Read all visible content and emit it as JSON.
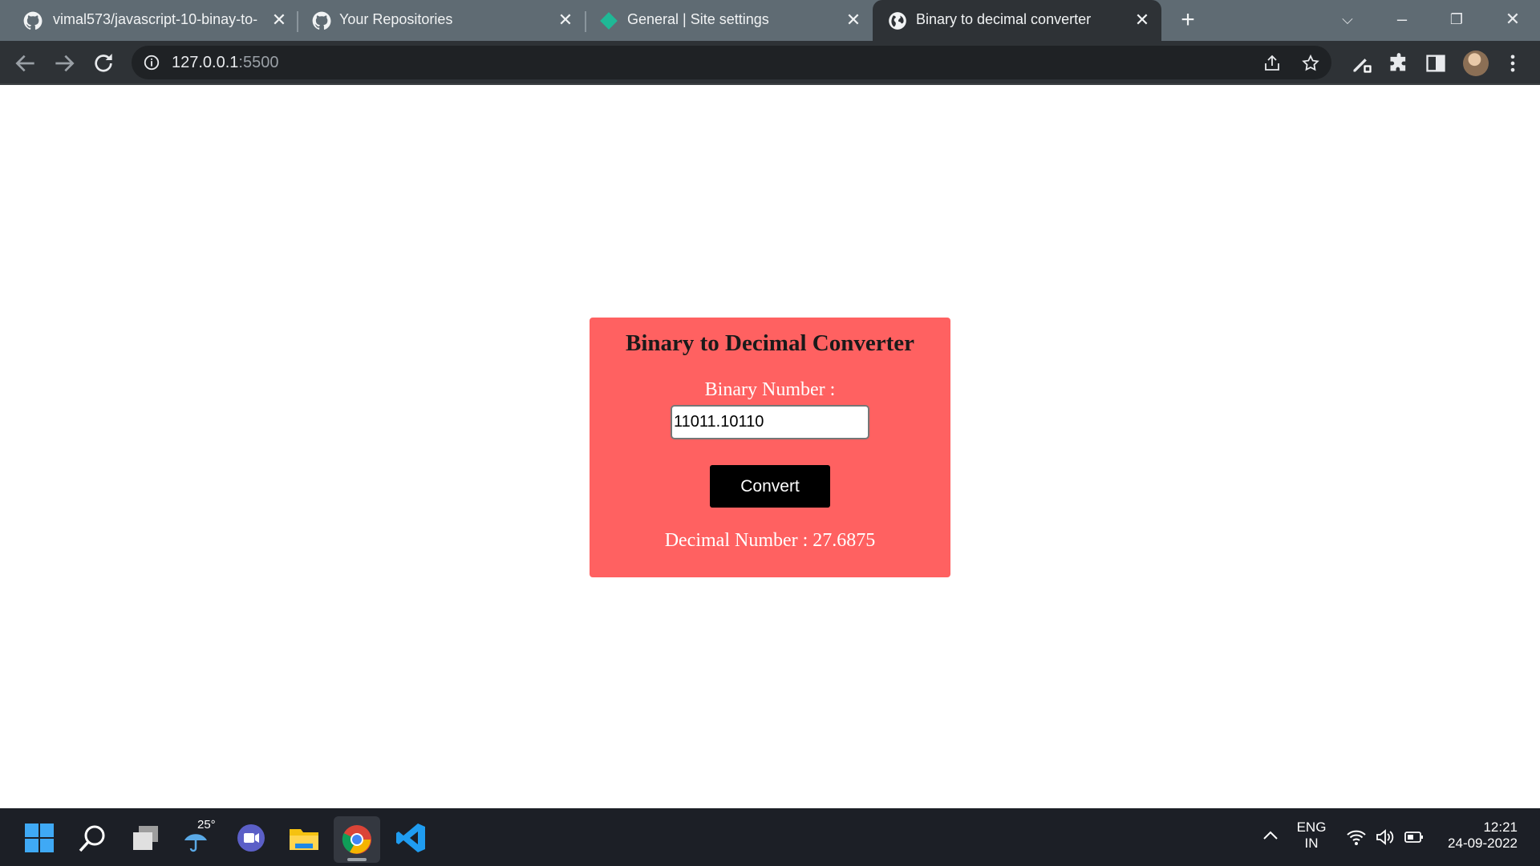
{
  "browser": {
    "tabs": [
      {
        "title": "vimal573/javascript-10-binay-to-"
      },
      {
        "title": "Your Repositories"
      },
      {
        "title": "General | Site settings"
      },
      {
        "title": "Binary to decimal converter"
      }
    ],
    "url_host": "127.0.0.1",
    "url_port": ":5500"
  },
  "card": {
    "title": "Binary to Decimal Converter",
    "input_label": "Binary Number :",
    "input_value": "11011.10110",
    "button_label": "Convert",
    "result": "Decimal Number : 27.6875"
  },
  "taskbar": {
    "weather_temp": "25°",
    "lang_top": "ENG",
    "lang_bottom": "IN",
    "time": "12:21",
    "date": "24-09-2022"
  },
  "colors": {
    "card_bg": "#ff6161",
    "tabstrip": "#5f6b73",
    "toolbar": "#2e3236",
    "taskbar": "#1c1f26"
  }
}
